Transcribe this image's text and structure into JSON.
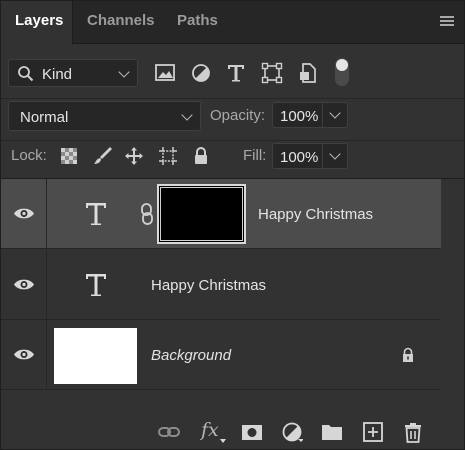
{
  "tabs": [
    {
      "label": "Layers",
      "active": true
    },
    {
      "label": "Channels",
      "active": false
    },
    {
      "label": "Paths",
      "active": false
    }
  ],
  "panel_menu_icon": "hamburger-menu-icon",
  "filter": {
    "kind_label": "Kind",
    "kind_icon": "search-icon",
    "filter_icons": [
      "pixel-layer-filter-icon",
      "adjustment-layer-filter-icon",
      "type-layer-filter-icon",
      "shape-layer-filter-icon",
      "smart-object-filter-icon",
      "filter-toggle-icon"
    ]
  },
  "blend": {
    "mode": "Normal",
    "opacity_label": "Opacity:",
    "opacity_value": "100%"
  },
  "lock": {
    "label": "Lock:",
    "icons": [
      "lock-transparent-pixels-icon",
      "lock-image-pixels-icon",
      "lock-position-icon",
      "lock-artboard-icon",
      "lock-all-icon"
    ],
    "fill_label": "Fill:",
    "fill_value": "100%"
  },
  "layers": [
    {
      "name": "Happy Christmas",
      "type": "text",
      "has_mask": true,
      "selected": true,
      "visible": true
    },
    {
      "name": "Happy Christmas",
      "type": "text",
      "has_mask": false,
      "selected": false,
      "visible": true
    },
    {
      "name": "Background",
      "type": "background",
      "locked": true,
      "selected": false,
      "visible": true
    }
  ],
  "bottom_toolbar": {
    "icons": [
      "link-layers-icon",
      "layer-style-fx-icon",
      "add-mask-icon",
      "new-adjustment-layer-icon",
      "new-group-folder-icon",
      "new-layer-icon",
      "delete-layer-icon"
    ],
    "fx_label": "fx"
  },
  "colors": {
    "panel_bg": "#323232",
    "tabbar_bg": "#262626",
    "selected_layer_bg": "#4c4c4c",
    "text": "#e4e4e4"
  }
}
